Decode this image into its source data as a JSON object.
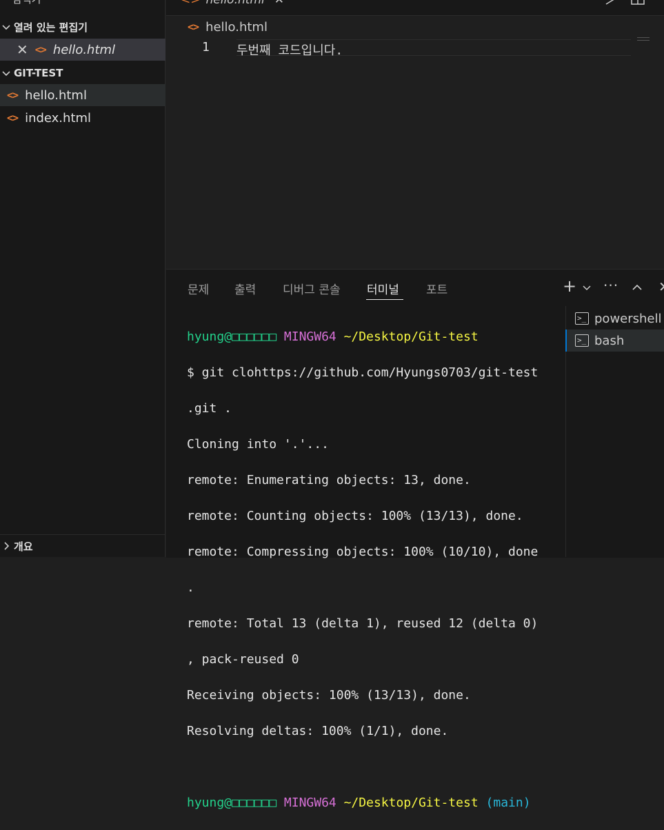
{
  "sidebar": {
    "top_partial": "탐색기",
    "open_editors_header": "열려 있는 편집기",
    "open_editor_file": "hello.html",
    "project_header": "GIT-TEST",
    "files": [
      "hello.html",
      "index.html"
    ],
    "outline_header": "개요"
  },
  "editor": {
    "tab_partial": "hello.html",
    "breadcrumb": "hello.html",
    "lines": [
      {
        "no": "1",
        "text": "두번째 코드입니다."
      }
    ]
  },
  "panel": {
    "tabs": [
      "문제",
      "출력",
      "디버그 콘솔",
      "터미널",
      "포트"
    ],
    "active_tab": "터미널",
    "terminal": {
      "prompt_user": "hyung@□□□□□□",
      "prompt_system": "MINGW64",
      "prompt_path": "~/Desktop/Git-test",
      "branch": "(main)",
      "lines": [
        "$ git clohttps://github.com/Hyungs0703/git-test",
        ".git .",
        "Cloning into '.'...",
        "remote: Enumerating objects: 13, done.",
        "remote: Counting objects: 100% (13/13), done.",
        "remote: Compressing objects: 100% (10/10), done",
        ".",
        "remote: Total 13 (delta 1), reused 12 (delta 0)",
        ", pack-reused 0",
        "Receiving objects: 100% (13/13), done.",
        "Resolving deltas: 100% (1/1), done."
      ]
    },
    "terminal_list": [
      "powershell",
      "bash"
    ],
    "active_terminal": "bash"
  },
  "colors": {
    "accent": "#0078d4",
    "html_icon": "#e37933",
    "prompt_green": "#23d18b",
    "prompt_magenta": "#d670d6",
    "prompt_yellow": "#f5f543",
    "prompt_cyan": "#29b8db"
  }
}
